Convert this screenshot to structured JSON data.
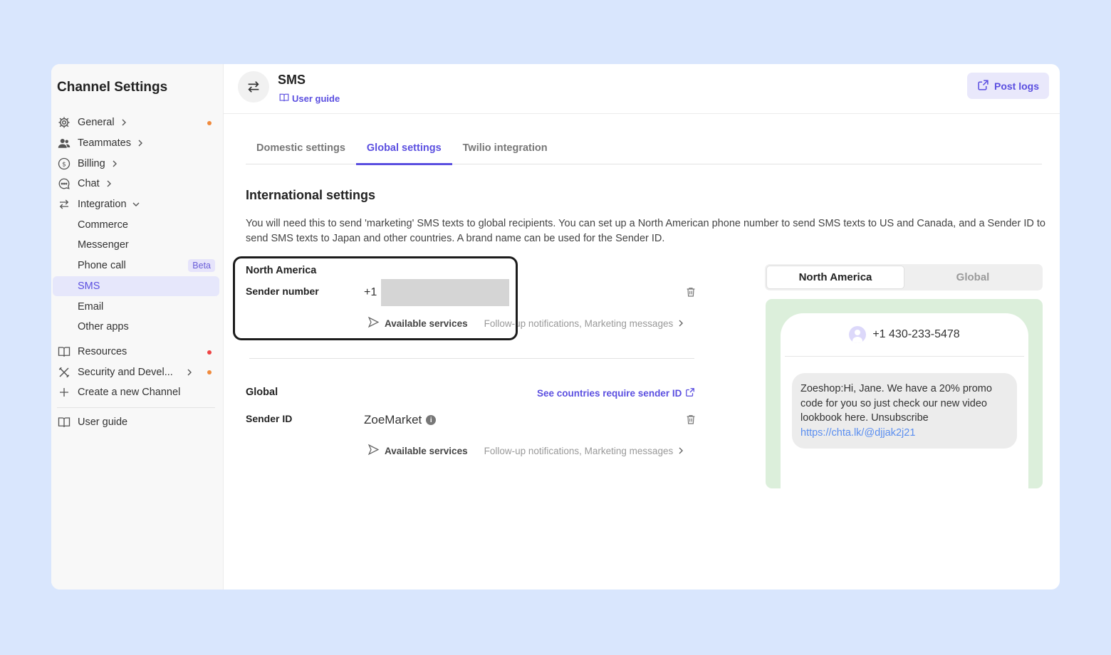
{
  "sidebar": {
    "title": "Channel Settings",
    "items": [
      {
        "label": "General",
        "icon": "gear-icon",
        "dot": "#f08a3c"
      },
      {
        "label": "Teammates",
        "icon": "users-icon"
      },
      {
        "label": "Billing",
        "icon": "dollar-icon"
      },
      {
        "label": "Chat",
        "icon": "chat-icon"
      },
      {
        "label": "Integration",
        "icon": "arrows-icon"
      }
    ],
    "sub_items": [
      {
        "label": "Commerce"
      },
      {
        "label": "Messenger"
      },
      {
        "label": "Phone call",
        "badge": "Beta"
      },
      {
        "label": "SMS"
      },
      {
        "label": "Email"
      },
      {
        "label": "Other apps"
      }
    ],
    "bottom_items": [
      {
        "label": "Resources",
        "icon": "book-icon",
        "dot": "#ef4444"
      },
      {
        "label": "Security and Devel...",
        "icon": "tools-icon",
        "dot": "#f08a3c"
      },
      {
        "label": "Create a new Channel",
        "icon": "plus-icon"
      }
    ],
    "user_guide": "User guide"
  },
  "header": {
    "title": "SMS",
    "user_guide_label": "User guide",
    "post_logs_label": "Post logs"
  },
  "tabs": [
    "Domestic settings",
    "Global settings",
    "Twilio integration"
  ],
  "active_tab": "Global settings",
  "international": {
    "title": "International settings",
    "description": "You will need this to send 'marketing' SMS texts to global recipients. You can set up a North American phone number to send SMS texts to US and Canada, and a Sender ID to send SMS texts to Japan and other countries. A brand name can be used for the Sender ID."
  },
  "north_america": {
    "label": "North America",
    "field_label": "Sender number",
    "prefix": "+1",
    "services_label": "Available services",
    "services_value": "Follow-up notifications, Marketing messages"
  },
  "global": {
    "label": "Global",
    "link_label": "See countries require sender ID",
    "field_label": "Sender ID",
    "sender_id": "ZoeMarket",
    "services_label": "Available services",
    "services_value": "Follow-up notifications, Marketing messages"
  },
  "preview": {
    "toggle": [
      "North America",
      "Global"
    ],
    "active": "North America",
    "phone_number": "+1 430-233-5478",
    "message_text": "Zoeshop:Hi, Jane. We have a 20% promo code for you so just check our new video lookbook here. Unsubscribe ",
    "message_link": "https://chta.lk/@djjak2j21"
  },
  "colors": {
    "accent": "#5b4fe0",
    "background": "#d9e6fd",
    "preview_bg": "#dcefdb"
  }
}
